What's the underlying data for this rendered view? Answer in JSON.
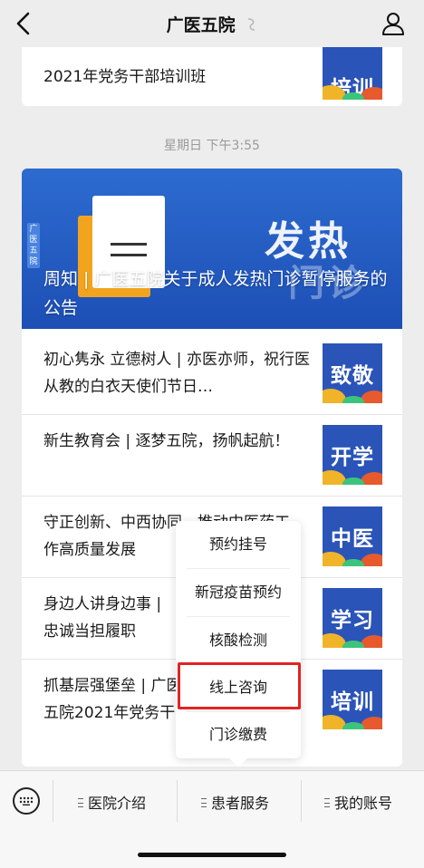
{
  "nav": {
    "title": "广医五院"
  },
  "top_article": {
    "text": "2021年党务干部培训班",
    "thumb": "培训"
  },
  "timestamp": "星期日 下午3:55",
  "banner": {
    "tag": "广医五院",
    "big_text": "发热",
    "big_text_2": "门诊",
    "title": "周知 | 广医五院关于成人发热门诊暂停服务的公告"
  },
  "articles": [
    {
      "text": "初心隽永 立德树人 | 亦医亦师，祝行医从教的白衣天使们节日…",
      "thumb": "致敬"
    },
    {
      "text": "新生教育会 | 逐梦五院，扬帆起航！",
      "thumb": "开学"
    },
    {
      "text": "守正创新、中西协同，推动中医药工作高质量发展",
      "thumb": "中医"
    },
    {
      "text": "身边人讲身边事 | 忠诚当担履职",
      "thumb": "学习"
    },
    {
      "text": "抓基层强堡垒 | 广医五院2021年党务干部培训班",
      "thumb": "培训"
    }
  ],
  "popup_menu": {
    "items": [
      "预约挂号",
      "新冠疫苗预约",
      "核酸检测",
      "线上咨询",
      "门诊缴费"
    ],
    "highlighted_index": 3
  },
  "tabbar": {
    "tabs": [
      "医院介绍",
      "患者服务",
      "我的账号"
    ]
  },
  "colors": {
    "accent_blue": "#2b54b8",
    "highlight_red": "#e02424"
  }
}
